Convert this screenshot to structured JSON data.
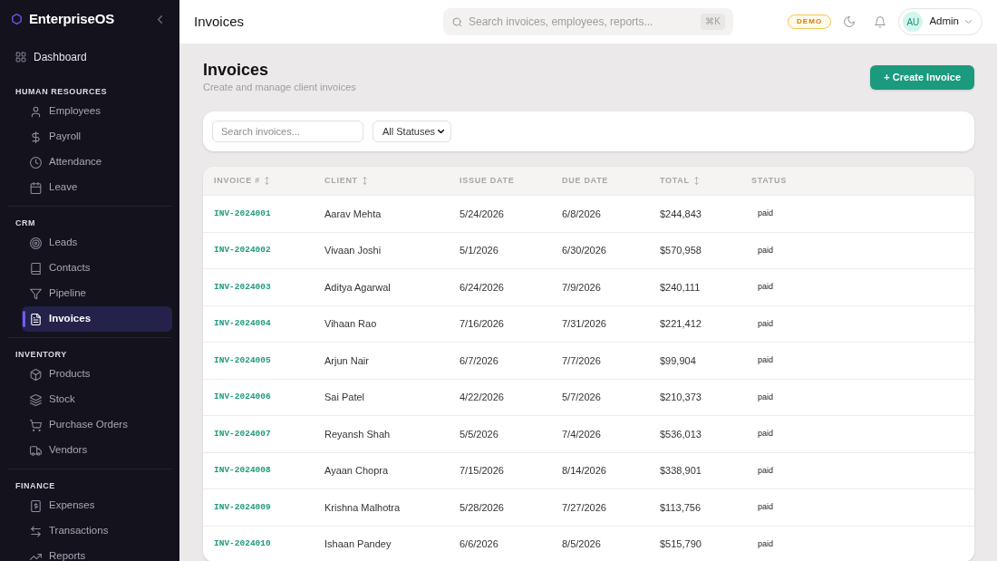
{
  "sidebar": {
    "brand": "EnterpriseOS",
    "top_item": {
      "label": "Dashboard",
      "selected": false
    },
    "sections": [
      {
        "title": "HUMAN RESOURCES",
        "items": [
          {
            "label": "Employees",
            "selected": false
          },
          {
            "label": "Payroll",
            "selected": false
          },
          {
            "label": "Attendance",
            "selected": false
          },
          {
            "label": "Leave",
            "selected": false
          }
        ]
      },
      {
        "title": "CRM",
        "items": [
          {
            "label": "Leads",
            "selected": false
          },
          {
            "label": "Contacts",
            "selected": false
          },
          {
            "label": "Pipeline",
            "selected": false
          },
          {
            "label": "Invoices",
            "selected": true
          }
        ]
      },
      {
        "title": "INVENTORY",
        "items": [
          {
            "label": "Products",
            "selected": false
          },
          {
            "label": "Stock",
            "selected": false
          },
          {
            "label": "Purchase Orders",
            "selected": false
          },
          {
            "label": "Vendors",
            "selected": false
          }
        ]
      },
      {
        "title": "FINANCE",
        "items": [
          {
            "label": "Expenses",
            "selected": false
          },
          {
            "label": "Transactions",
            "selected": false
          },
          {
            "label": "Reports",
            "selected": false
          }
        ]
      }
    ]
  },
  "header": {
    "title": "Invoices",
    "search": {
      "placeholder": "Search invoices, employees, reports...",
      "shortcut": "⌘K"
    },
    "badge": "DEMO",
    "user": {
      "initials": "AU",
      "name": "Admin"
    }
  },
  "page": {
    "title": "Invoices",
    "subtitle": "Create and manage client invoices",
    "create_button": "+ Create Invoice"
  },
  "filters": {
    "search": {
      "placeholder": "Search invoices..."
    },
    "status_select": {
      "value": "All Statuses"
    }
  },
  "table": {
    "columns": [
      {
        "label": "INVOICE #",
        "sortable": true
      },
      {
        "label": "CLIENT",
        "sortable": true
      },
      {
        "label": "ISSUE DATE",
        "sortable": false
      },
      {
        "label": "DUE DATE",
        "sortable": false
      },
      {
        "label": "TOTAL",
        "sortable": true
      },
      {
        "label": "STATUS",
        "sortable": false
      }
    ],
    "rows": [
      {
        "invoice": "INV-2024001",
        "client": "Aarav Mehta",
        "issue_date": "5/24/2026",
        "due_date": "6/8/2026",
        "total": "$244,843",
        "status": "paid"
      },
      {
        "invoice": "INV-2024002",
        "client": "Vivaan Joshi",
        "issue_date": "5/1/2026",
        "due_date": "6/30/2026",
        "total": "$570,958",
        "status": "paid"
      },
      {
        "invoice": "INV-2024003",
        "client": "Aditya Agarwal",
        "issue_date": "6/24/2026",
        "due_date": "7/9/2026",
        "total": "$240,111",
        "status": "paid"
      },
      {
        "invoice": "INV-2024004",
        "client": "Vihaan Rao",
        "issue_date": "7/16/2026",
        "due_date": "7/31/2026",
        "total": "$221,412",
        "status": "paid"
      },
      {
        "invoice": "INV-2024005",
        "client": "Arjun Nair",
        "issue_date": "6/7/2026",
        "due_date": "7/7/2026",
        "total": "$99,904",
        "status": "paid"
      },
      {
        "invoice": "INV-2024006",
        "client": "Sai Patel",
        "issue_date": "4/22/2026",
        "due_date": "5/7/2026",
        "total": "$210,373",
        "status": "paid"
      },
      {
        "invoice": "INV-2024007",
        "client": "Reyansh Shah",
        "issue_date": "5/5/2026",
        "due_date": "7/4/2026",
        "total": "$536,013",
        "status": "paid"
      },
      {
        "invoice": "INV-2024008",
        "client": "Ayaan Chopra",
        "issue_date": "7/15/2026",
        "due_date": "8/14/2026",
        "total": "$338,901",
        "status": "paid"
      },
      {
        "invoice": "INV-2024009",
        "client": "Krishna Malhotra",
        "issue_date": "5/28/2026",
        "due_date": "7/27/2026",
        "total": "$113,756",
        "status": "paid"
      },
      {
        "invoice": "INV-2024010",
        "client": "Ishaan Pandey",
        "issue_date": "6/6/2026",
        "due_date": "8/5/2026",
        "total": "$515,790",
        "status": "paid"
      }
    ]
  }
}
